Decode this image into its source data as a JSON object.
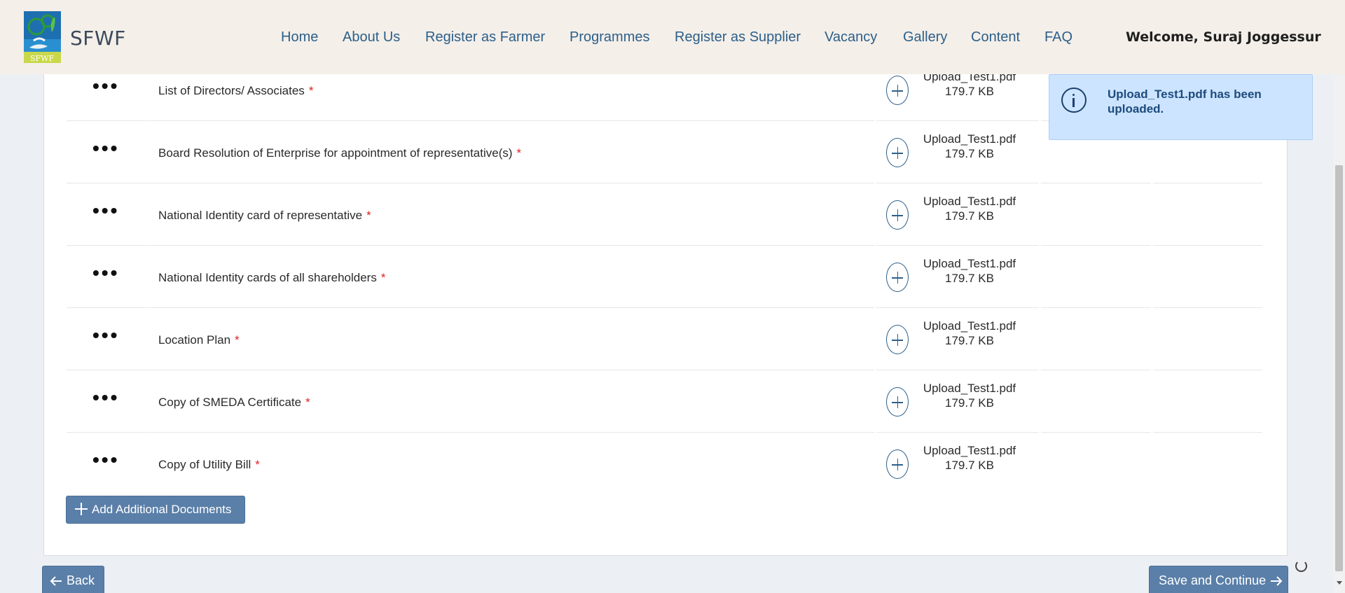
{
  "header": {
    "brand": "SFWF",
    "logo_text": "SFWF",
    "nav": [
      "Home",
      "About Us",
      "Register as Farmer",
      "Programmes",
      "Register as Supplier",
      "Vacancy",
      "Gallery",
      "Content",
      "FAQ"
    ],
    "welcome": "Welcome, Suraj Joggessur"
  },
  "toast": {
    "icon": "info-icon",
    "message": "Upload_Test1.pdf has been uploaded."
  },
  "documents": [
    {
      "label": "List of Directors/ Associates",
      "required": "*",
      "file_name": "Upload_Test1.pdf",
      "file_size": "179.7 KB"
    },
    {
      "label": "Board Resolution of Enterprise for appointment of representative(s)",
      "required": "*",
      "file_name": "Upload_Test1.pdf",
      "file_size": "179.7 KB"
    },
    {
      "label": "National Identity card of representative",
      "required": "*",
      "file_name": "Upload_Test1.pdf",
      "file_size": "179.7 KB"
    },
    {
      "label": "National Identity cards of all shareholders",
      "required": "*",
      "file_name": "Upload_Test1.pdf",
      "file_size": "179.7 KB"
    },
    {
      "label": "Location Plan",
      "required": "*",
      "file_name": "Upload_Test1.pdf",
      "file_size": "179.7 KB"
    },
    {
      "label": "Copy of SMEDA Certificate",
      "required": "*",
      "file_name": "Upload_Test1.pdf",
      "file_size": "179.7 KB"
    },
    {
      "label": "Copy of Utility Bill",
      "required": "*",
      "file_name": "Upload_Test1.pdf",
      "file_size": "179.7 KB"
    }
  ],
  "row_menu_glyph": "•••",
  "actions": {
    "add_documents": "Add Additional Documents",
    "back": "Back",
    "save_continue": "Save and Continue"
  },
  "colors": {
    "header_bg": "#f4efe9",
    "nav_link": "#2c5f8a",
    "button_bg": "#5a7fa8",
    "toast_bg": "#cce4ff",
    "toast_text": "#1d4b7d",
    "required": "#e02020"
  }
}
